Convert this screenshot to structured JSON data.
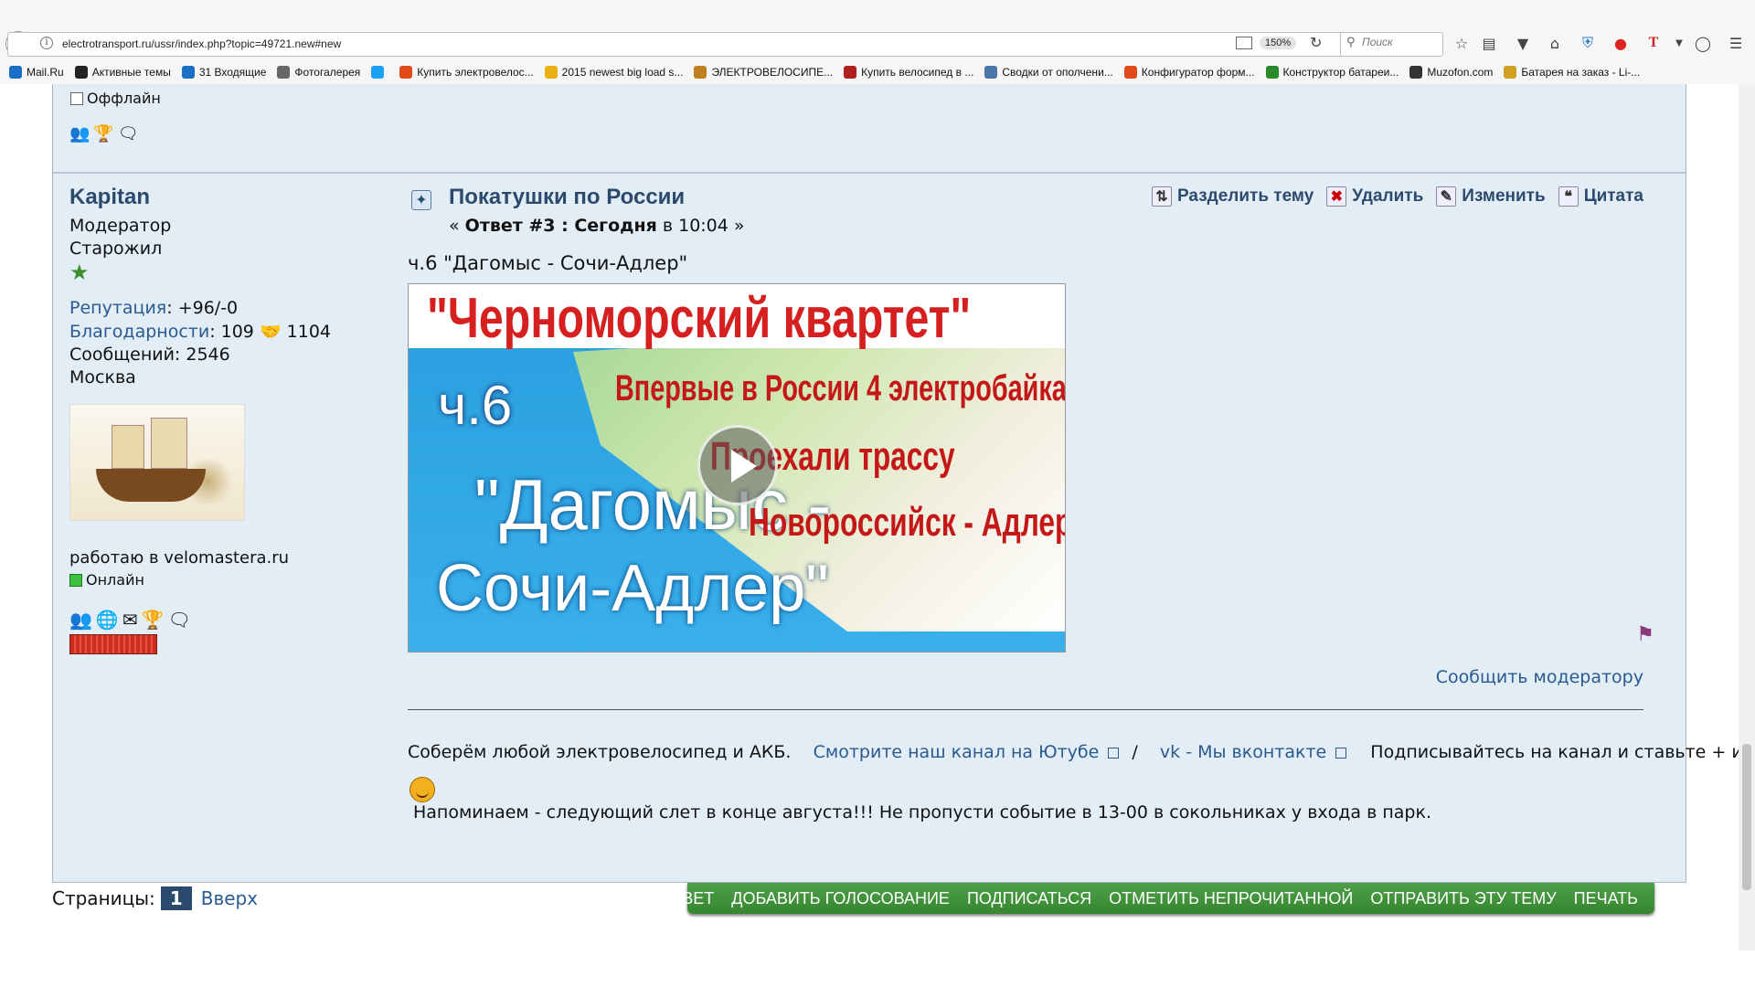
{
  "browser": {
    "url": "electrotransport.ru/ussr/index.php?topic=49721.new#new",
    "zoom": "150%",
    "search_placeholder": "Поиск",
    "bookmarks": [
      {
        "label": "Mail.Ru",
        "color": "#1a6fc4"
      },
      {
        "label": "Активные темы",
        "color": "#222222"
      },
      {
        "label": "31  Входящие",
        "color": "#1a6fc4"
      },
      {
        "label": "Фотогалерея",
        "color": "#666666"
      },
      {
        "label": "",
        "color": "#1da1f2"
      },
      {
        "label": "Купить электровелос...",
        "color": "#e04a1a"
      },
      {
        "label": "2015 newest big load s...",
        "color": "#e8b010"
      },
      {
        "label": "ЭЛЕКТРОВЕЛОСИПЕ...",
        "color": "#c08020"
      },
      {
        "label": "Купить велосипед в ...",
        "color": "#b02020"
      },
      {
        "label": "Сводки от ополчени...",
        "color": "#4a76a8"
      },
      {
        "label": "Конфигуратор форм...",
        "color": "#e04a1a"
      },
      {
        "label": "Конструктор батареи...",
        "color": "#2a8a2a"
      },
      {
        "label": "Muzofon.com",
        "color": "#333333"
      },
      {
        "label": "Батарея на заказ - Li-...",
        "color": "#d0a020"
      }
    ]
  },
  "prev_post": {
    "status": "Оффлайн"
  },
  "author": {
    "name": "Kapitan",
    "role": "Модератор",
    "rank": "Старожил",
    "reputation_label": "Репутация",
    "reputation_value": ": +96/-0",
    "thanks_label": "Благодарности",
    "thanks_given": ": 109",
    "thanks_received": "1104",
    "messages": "Сообщений: 2546",
    "city": "Москва",
    "signature": "работаю в velomastera.ru",
    "status": "Онлайн"
  },
  "post": {
    "title": "Покатушки по России",
    "meta_prefix": "« ",
    "meta_reply": "Ответ #3 : Сегодня",
    "meta_time": " в 10:04 »",
    "actions": [
      "Разделить тему",
      "Удалить",
      "Изменить",
      "Цитата"
    ],
    "subtitle": "ч.6 \"Дагомыс - Сочи-Адлер\"",
    "video": {
      "title": "\"Черноморский квартет\"",
      "line2": "Впервые в России 4 электробайка",
      "part": "ч.6",
      "line3": "Проехали  трассу",
      "name1": "\"Дагомыс -",
      "line4": "Новороссийск - Адлер",
      "name2": "Сочи-Адлер\""
    },
    "report": "Сообщить модератору"
  },
  "signature": {
    "text1": "Соберём любой электровелосипед и АКБ.",
    "link1": "Смотрите наш канал на  Ютубе",
    "sep": "/",
    "link2": "vk - Мы вконтакте",
    "text2": "Подписывайтесь на канал и ставьте + и лайки!!!",
    "text3": "Напоминаем - следующий слет  в конце августа!!! Не пропусти событие в 13-00 в сокольниках у входа в парк."
  },
  "pager": {
    "label": "Страницы:",
    "current": "1",
    "top": "Вверх"
  },
  "buttons": [
    "ОТВЕТ",
    "ДОБАВИТЬ ГОЛОСОВАНИЕ",
    "ПОДПИСАТЬСЯ",
    "ОТМЕТИТЬ НЕПРОЧИТАННОЙ",
    "ОТПРАВИТЬ ЭТУ ТЕМУ",
    "ПЕЧАТЬ"
  ]
}
